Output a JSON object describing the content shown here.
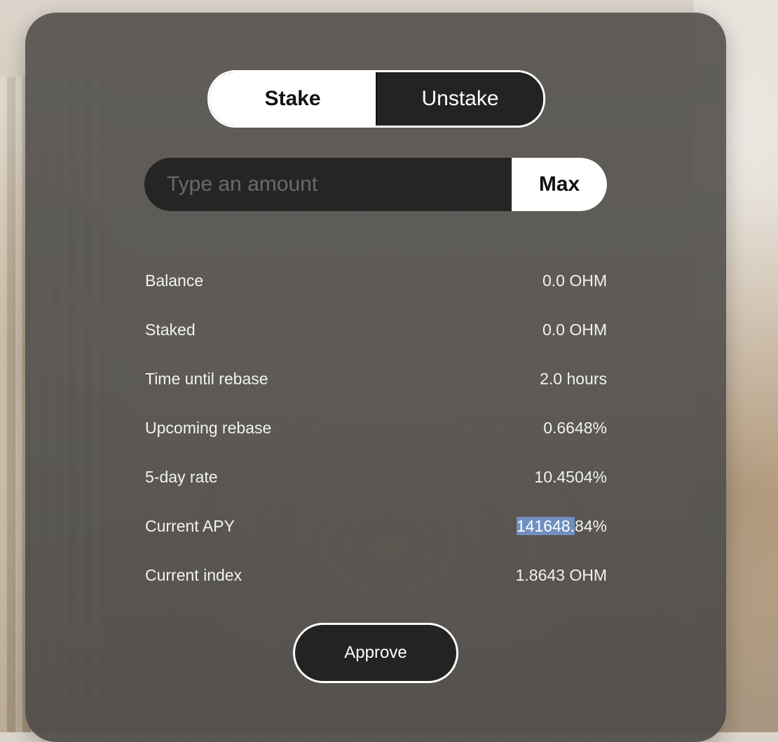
{
  "tabs": {
    "stake": "Stake",
    "unstake": "Unstake"
  },
  "amount": {
    "placeholder": "Type an amount",
    "value": "",
    "max_label": "Max"
  },
  "stats": [
    {
      "label": "Balance",
      "value": "0.0 OHM"
    },
    {
      "label": "Staked",
      "value": "0.0 OHM"
    },
    {
      "label": "Time until rebase",
      "value": "2.0 hours"
    },
    {
      "label": "Upcoming rebase",
      "value": "0.6648%"
    },
    {
      "label": "5-day rate",
      "value": "10.4504%"
    },
    {
      "label": "Current APY",
      "value_highlight": "141648.",
      "value_rest": "84%"
    },
    {
      "label": "Current index",
      "value": "1.8643 OHM"
    }
  ],
  "approve_label": "Approve",
  "colors": {
    "card": "#565451",
    "dark": "#232323",
    "light": "#ffffff",
    "selection_highlight": "#6f8fbf"
  }
}
